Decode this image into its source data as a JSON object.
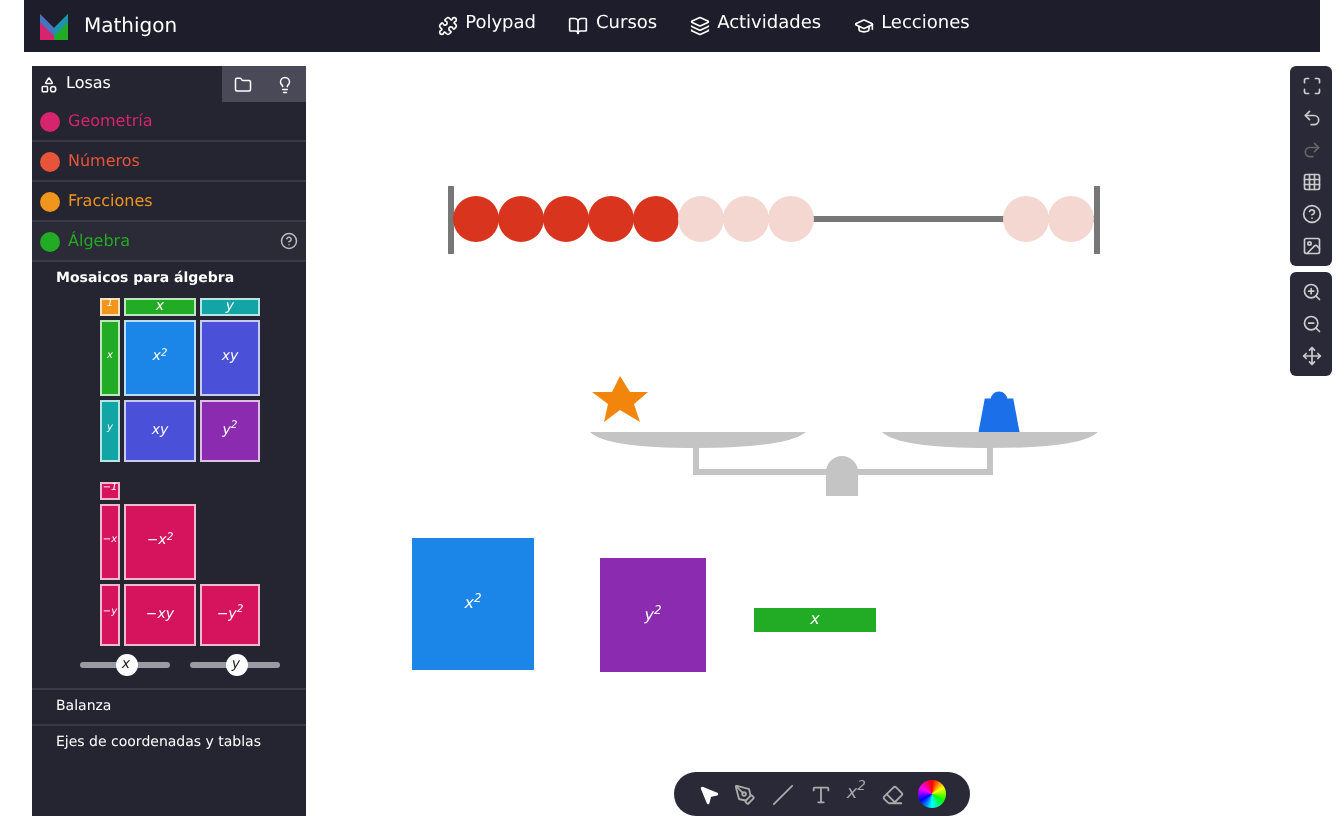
{
  "navbar": {
    "brand": "Mathigon",
    "links": [
      {
        "label": "Polypad"
      },
      {
        "label": "Cursos"
      },
      {
        "label": "Actividades"
      },
      {
        "label": "Lecciones"
      }
    ]
  },
  "sidebar": {
    "tabs": [
      {
        "kind": "text",
        "label": "Losas",
        "selected": true
      },
      {
        "kind": "folder",
        "selected": false
      },
      {
        "kind": "bulb",
        "selected": false
      }
    ],
    "categories": [
      {
        "label": "Geometría",
        "color": "#d6246e",
        "expanded": false
      },
      {
        "label": "Números",
        "color": "#e8533a",
        "expanded": false
      },
      {
        "label": "Fracciones",
        "color": "#f2951c",
        "expanded": false
      },
      {
        "label": "Álgebra",
        "color": "#22ab24",
        "expanded": true
      }
    ],
    "section_title": "Mosaicos para álgebra",
    "positive_tiles": [
      [
        {
          "label": "1",
          "color": "#f2951c"
        },
        {
          "label": "x",
          "color": "#22ab24"
        },
        {
          "label": "y",
          "color": "#12a5a5"
        }
      ],
      [
        {
          "label": "x",
          "color": "#22ab24"
        },
        {
          "label": "x$^{2}$",
          "color": "#1b86e8"
        },
        {
          "label": "xy",
          "color": "#4b50d8"
        }
      ],
      [
        {
          "label": "y",
          "color": "#12a5a5"
        },
        {
          "label": "xy",
          "color": "#4b50d8"
        },
        {
          "label": "y$^{2}$",
          "color": "#8b2bb0"
        }
      ]
    ],
    "negative_tiles": [
      [
        {
          "label": "−1",
          "color": "#d6145e"
        }
      ],
      [
        {
          "label": "−x",
          "color": "#d6145e"
        },
        {
          "label": "−x$^{2}$",
          "color": "#d6145e"
        }
      ],
      [
        {
          "label": "−y",
          "color": "#d6145e"
        },
        {
          "label": "−xy",
          "color": "#d6145e"
        },
        {
          "label": "−y$^{2}$",
          "color": "#d6145e"
        }
      ]
    ],
    "sliders": [
      {
        "label": "x",
        "level": 0.5
      },
      {
        "label": "y",
        "level": 0.5
      }
    ],
    "subsections": [
      "Balanza",
      "Ejes de coordenadas y tablas"
    ]
  },
  "canvas": {
    "tiles": [
      {
        "kind": "x2",
        "label": "x$^{2}$"
      },
      {
        "kind": "y2",
        "label": "y$^{2}$"
      },
      {
        "kind": "x",
        "label": "x"
      }
    ]
  },
  "drawing_toolbar": {
    "tools": [
      {
        "kind": "pointer",
        "selected": true
      },
      {
        "kind": "pen",
        "selected": false
      },
      {
        "kind": "line",
        "selected": false
      },
      {
        "kind": "textbox",
        "selected": false
      },
      {
        "kind": "equation",
        "label": "x$^{2}$",
        "selected": false
      },
      {
        "kind": "eraser",
        "selected": false
      },
      {
        "kind": "color",
        "selected": false
      }
    ]
  }
}
